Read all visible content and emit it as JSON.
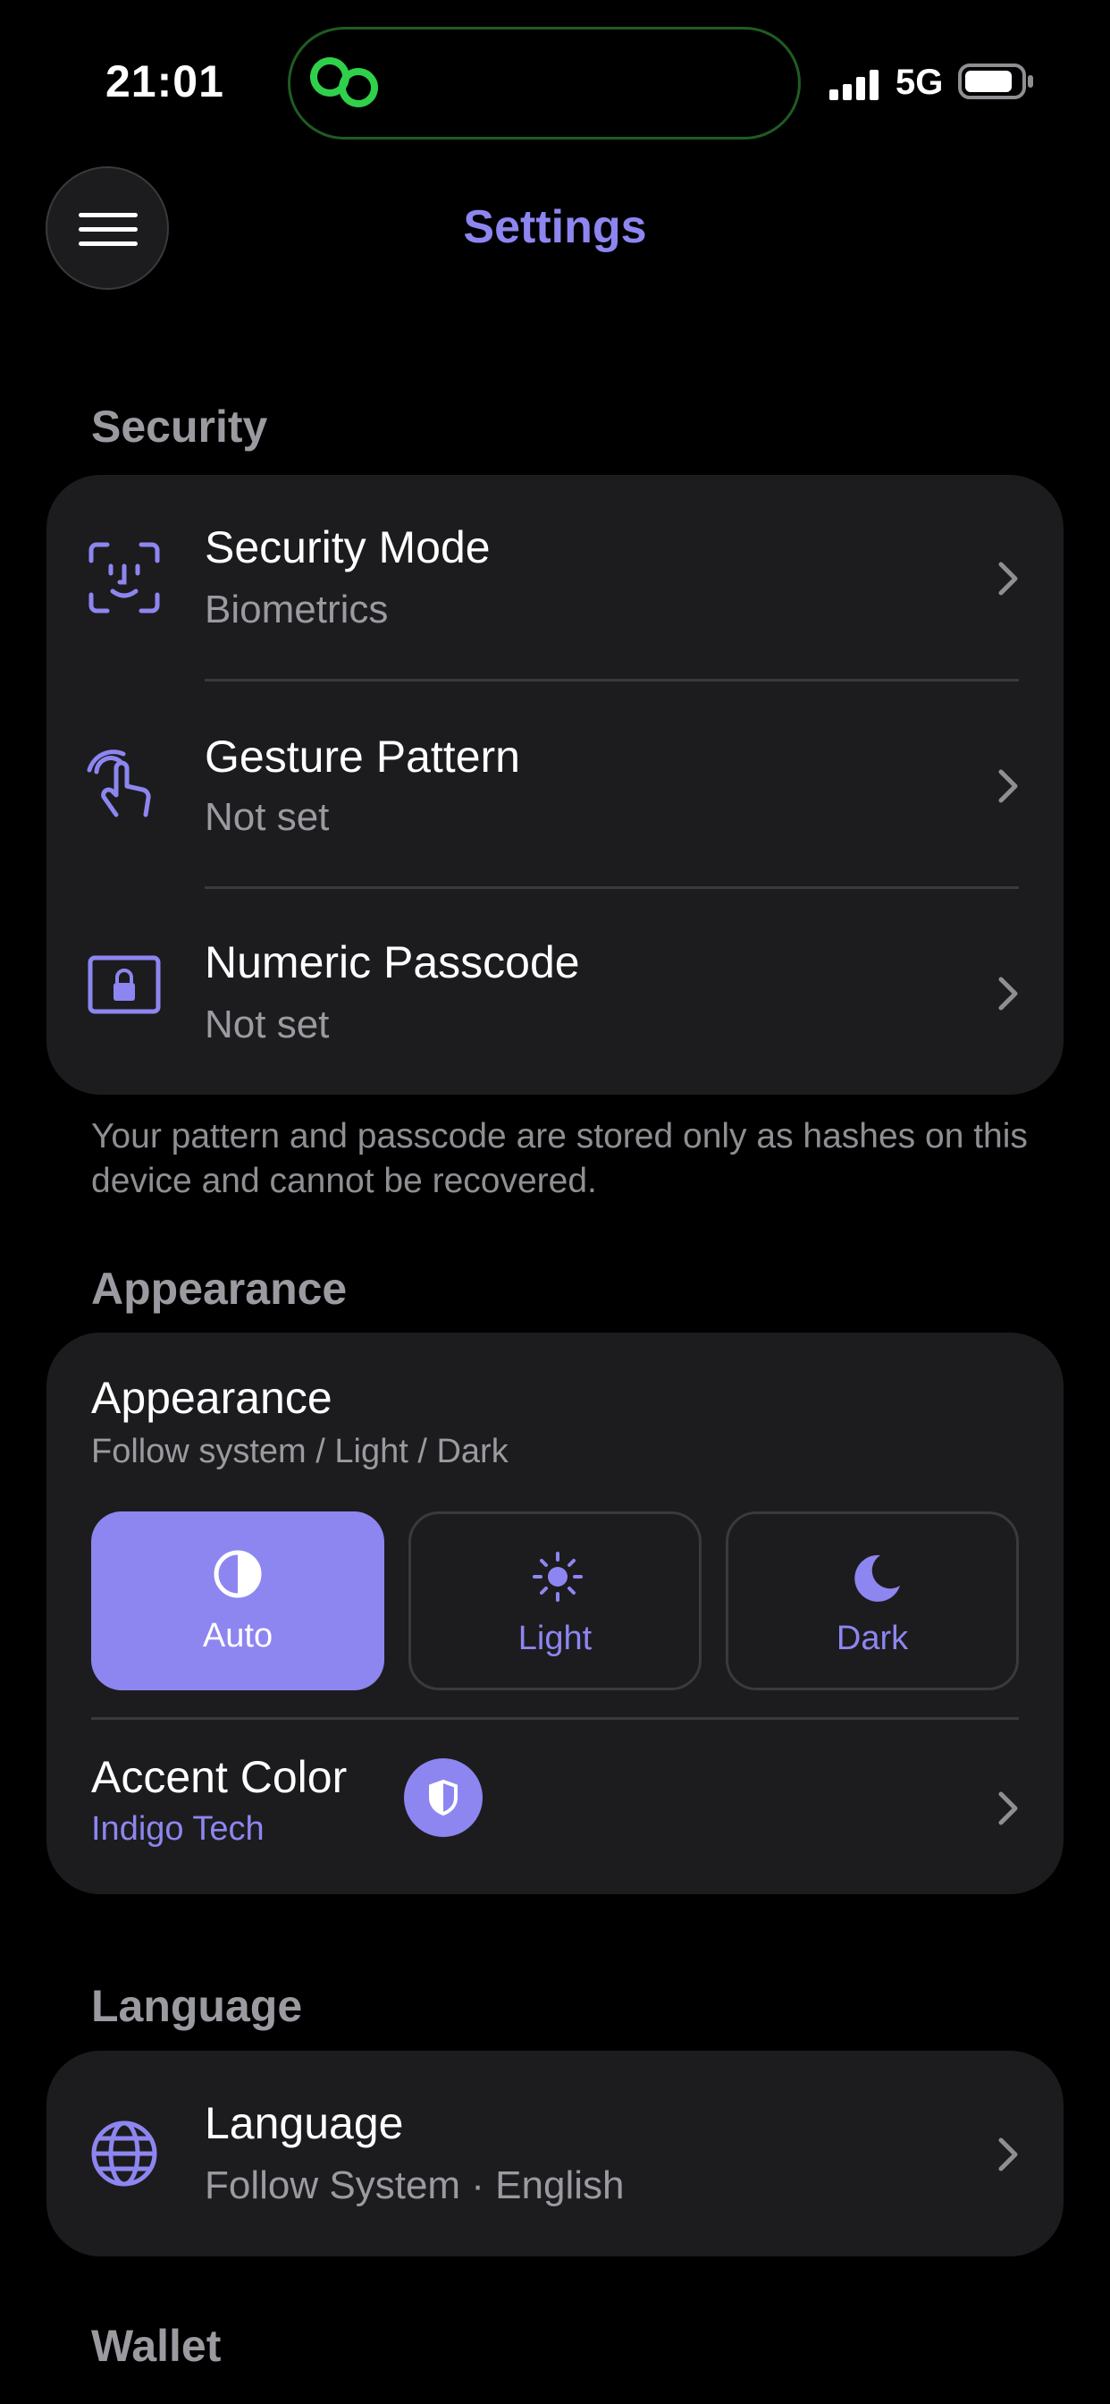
{
  "status_bar": {
    "time": "21:01",
    "network": "5G"
  },
  "header": {
    "title": "Settings"
  },
  "sections": {
    "security": "Security",
    "appearance": "Appearance",
    "language": "Language",
    "wallet": "Wallet"
  },
  "security": {
    "items": [
      {
        "title": "Security Mode",
        "subtitle": "Biometrics",
        "icon": "face-id-icon"
      },
      {
        "title": "Gesture Pattern",
        "subtitle": "Not set",
        "icon": "hand-gesture-icon"
      },
      {
        "title": "Numeric Passcode",
        "subtitle": "Not set",
        "icon": "lock-icon"
      }
    ],
    "note": "Your pattern and passcode are stored only as hashes on this device and cannot be recovered."
  },
  "appearance": {
    "title": "Appearance",
    "subtitle": "Follow system / Light / Dark",
    "options": [
      {
        "label": "Auto",
        "icon": "half-circle-icon",
        "selected": true
      },
      {
        "label": "Light",
        "icon": "sun-icon",
        "selected": false
      },
      {
        "label": "Dark",
        "icon": "moon-icon",
        "selected": false
      }
    ],
    "accent": {
      "title": "Accent Color",
      "value": "Indigo Tech",
      "color": "#8d86f0"
    }
  },
  "language": {
    "title": "Language",
    "subtitle": "Follow System · English",
    "icon": "globe-icon"
  },
  "colors": {
    "accent": "#8d86f0",
    "background": "#000000",
    "card": "#1c1c1e"
  }
}
